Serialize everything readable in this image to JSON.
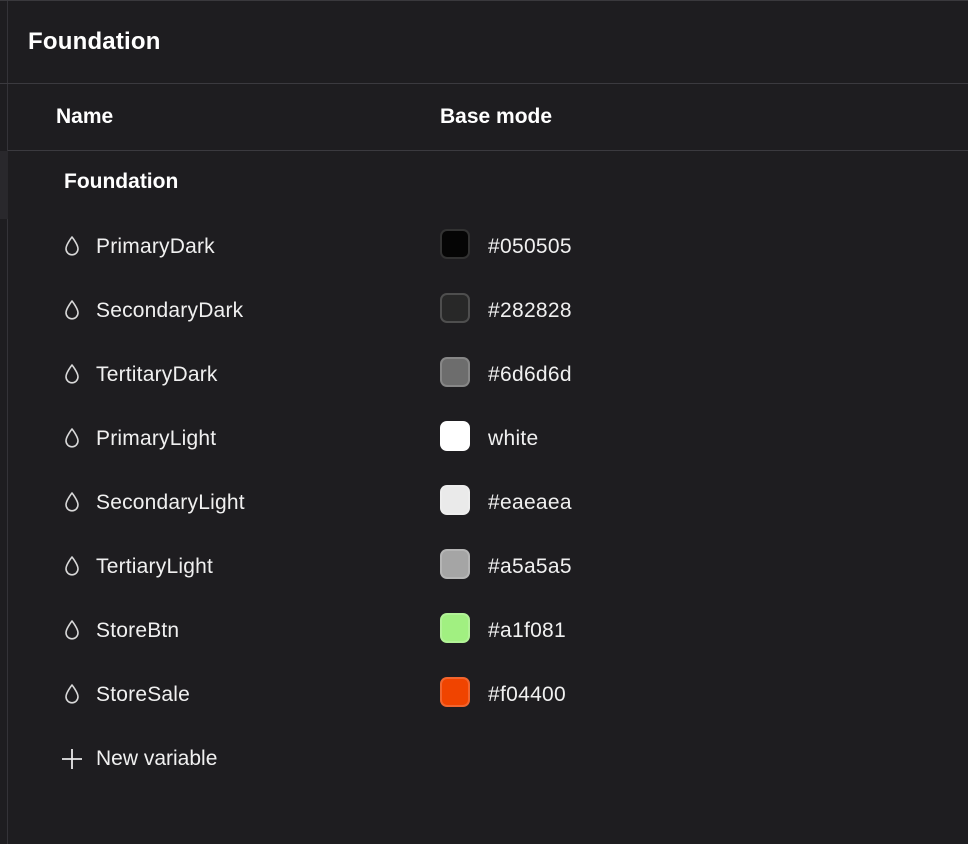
{
  "panel": {
    "title": "Foundation"
  },
  "table": {
    "col_name": "Name",
    "col_mode": "Base mode"
  },
  "group": {
    "title": "Foundation"
  },
  "variables": [
    {
      "name": "PrimaryDark",
      "value": "#050505",
      "color": "#050505"
    },
    {
      "name": "SecondaryDark",
      "value": "#282828",
      "color": "#282828"
    },
    {
      "name": "TertitaryDark",
      "value": "#6d6d6d",
      "color": "#6d6d6d"
    },
    {
      "name": "PrimaryLight",
      "value": "white",
      "color": "#ffffff"
    },
    {
      "name": "SecondaryLight",
      "value": "#eaeaea",
      "color": "#eaeaea"
    },
    {
      "name": "TertiaryLight",
      "value": "#a5a5a5",
      "color": "#a5a5a5"
    },
    {
      "name": "StoreBtn",
      "value": "#a1f081",
      "color": "#a1f081"
    },
    {
      "name": "StoreSale",
      "value": "#f04400",
      "color": "#f04400"
    }
  ],
  "variable_icon": "color-drop-icon",
  "new_variable": {
    "label": "New variable",
    "icon": "plus-icon"
  }
}
